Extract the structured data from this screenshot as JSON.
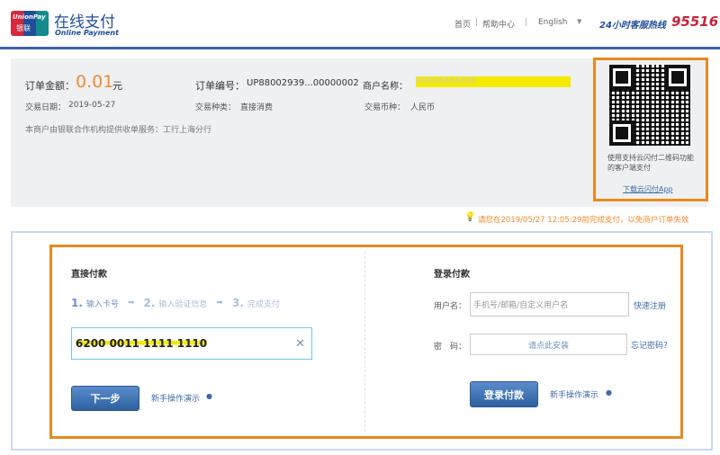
{
  "header": {
    "brand_cn": "在线支付",
    "brand_en": "Online Payment",
    "logo_text_en": "UnionPay",
    "logo_text_cn": "银联",
    "nav_home": "首页",
    "nav_help": "帮助中心",
    "language": "English",
    "hotline_label": "24小时客服热线",
    "hotline_number": "95516"
  },
  "order": {
    "amount_label": "订单金额：",
    "amount": "0.01",
    "amount_unit": "元",
    "order_no_label": "订单编号：",
    "order_no": "UP88002939...00000002",
    "merchant_label": "商户名称：",
    "merchant_name": "XXXXXXXXXXX",
    "date_label": "交易日期：",
    "date": "2019-05-27",
    "type_label": "交易种类：",
    "type": "直接消费",
    "currency_label": "交易币种：",
    "currency": "人民币",
    "service_note": "本商户由银联合作机构提供收单服务：工行上海分行"
  },
  "qr": {
    "caption": "使用支持云闪付二维码功能的客户端支付",
    "download_link": "下载云闪付App"
  },
  "warning": "请您在2019/05/27 12:05:29前完成支付，以免商户订单失效",
  "direct": {
    "title": "直接付款",
    "steps": [
      "1.",
      "输入卡号",
      "2.",
      "输入验证信息",
      "3.",
      "完成支付"
    ],
    "card_value": "6200 0011 1111 1110",
    "next_button": "下一步",
    "guide_link": "新手操作演示"
  },
  "login": {
    "title": "登录付款",
    "username_label": "用户名：",
    "username_placeholder": "手机号/邮箱/自定义用户名",
    "register_link": "快速注册",
    "password_label": "密　码：",
    "password_hint": "请点此安装",
    "forgot_link": "忘记密码？",
    "login_button": "登录付款",
    "guide_link": "新手操作演示"
  },
  "colors": {
    "accent": "#3b64a8",
    "highlight": "#e8891f",
    "amount": "#f08a2c"
  }
}
